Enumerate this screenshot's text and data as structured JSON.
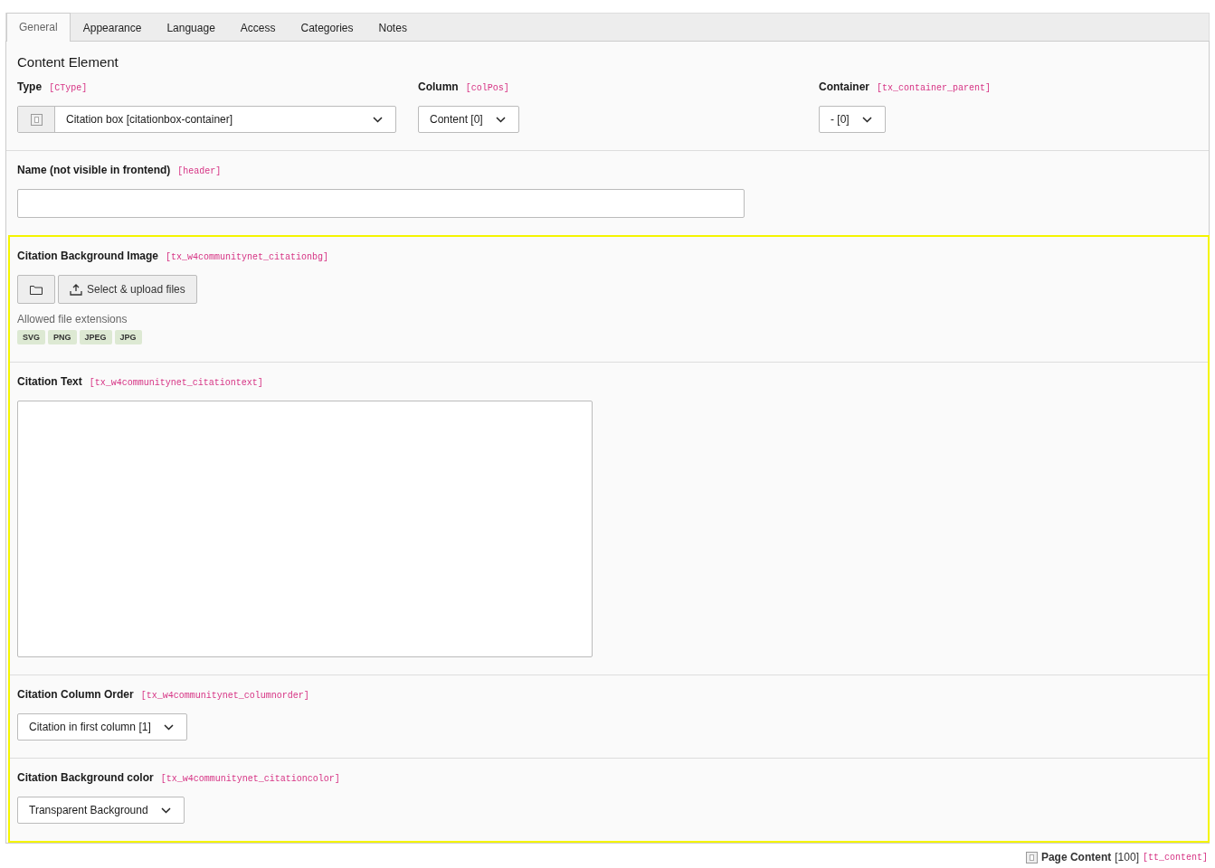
{
  "tabs": [
    {
      "label": "General",
      "selected": true
    },
    {
      "label": "Appearance",
      "selected": false
    },
    {
      "label": "Language",
      "selected": false
    },
    {
      "label": "Access",
      "selected": false
    },
    {
      "label": "Categories",
      "selected": false
    },
    {
      "label": "Notes",
      "selected": false
    }
  ],
  "sections": [
    {
      "title": "Content Element",
      "fields": [
        {
          "kind": "select",
          "label": "Type",
          "field_name": "[CType]",
          "value": "Citation box [citationbox-container]",
          "with_icon": true
        },
        {
          "kind": "select",
          "label": "Column",
          "field_name": "[colPos]",
          "value": "Content [0]"
        },
        {
          "kind": "select",
          "label": "Container",
          "field_name": "[tx_container_parent]",
          "value": "- [0]"
        }
      ]
    },
    {
      "fields": [
        {
          "kind": "input",
          "label": "Name (not visible in frontend)",
          "field_name": "[header]"
        }
      ]
    },
    {
      "highlighted": true,
      "fields": [
        {
          "kind": "files",
          "label": "Citation Background Image",
          "field_name": "[tx_w4communitynet_citationbg]",
          "button": "Select & upload files",
          "hint": "Allowed file extensions",
          "extensions": [
            "SVG",
            "PNG",
            "JPEG",
            "JPG"
          ]
        }
      ]
    },
    {
      "highlighted": true,
      "fields": [
        {
          "kind": "textarea",
          "label": "Citation Text",
          "field_name": "[tx_w4communitynet_citationtext]"
        }
      ]
    },
    {
      "highlighted": true,
      "fields": [
        {
          "kind": "select",
          "label": "Citation Column Order",
          "field_name": "[tx_w4communitynet_columnorder]",
          "value": "Citation in first column [1]"
        }
      ]
    },
    {
      "highlighted": true,
      "fields": [
        {
          "kind": "select",
          "label": "Citation Background color",
          "field_name": "[tx_w4communitynet_citationcolor]",
          "value": "Transparent Background"
        }
      ]
    }
  ],
  "footer": {
    "table": "Page Content",
    "uid": "[100]",
    "table_name": "[tt_content]"
  }
}
